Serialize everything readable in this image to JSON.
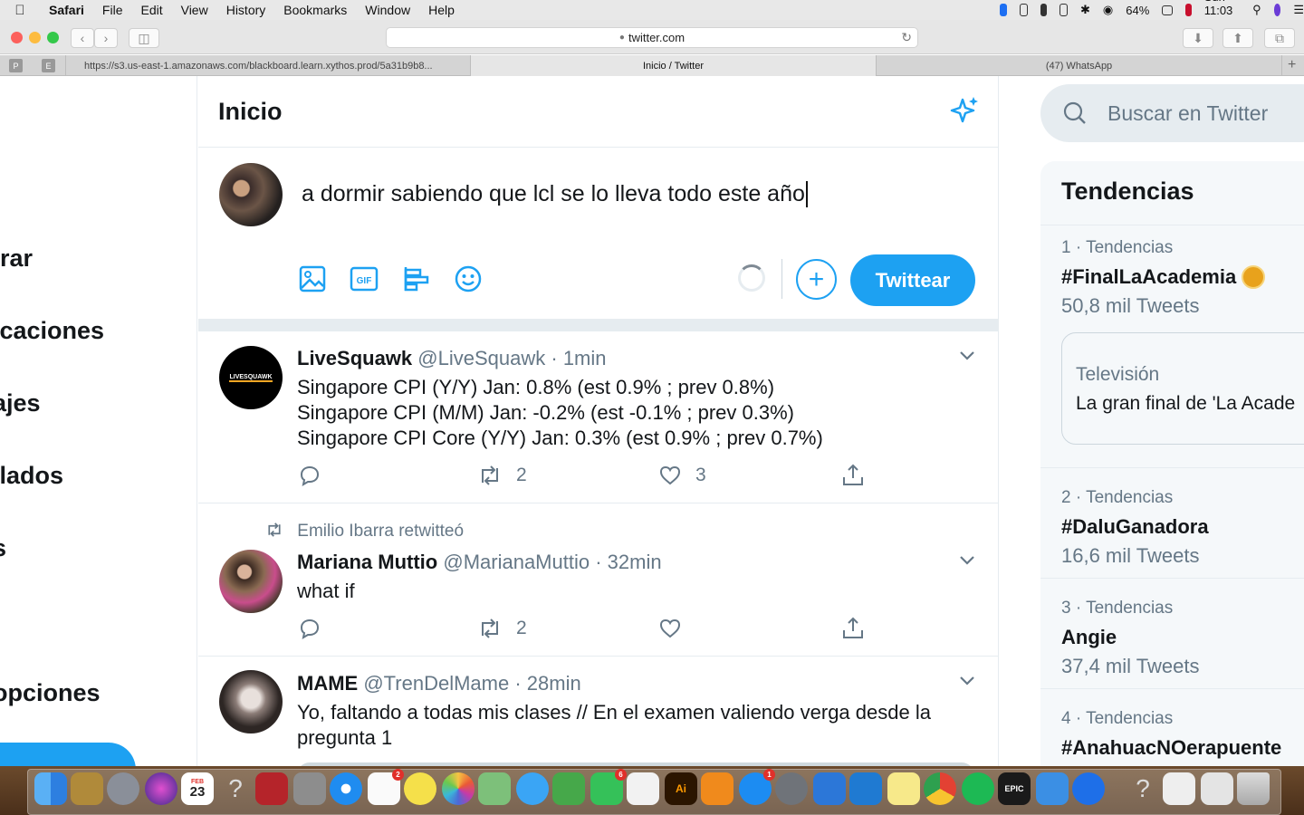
{
  "menubar": {
    "app": "Safari",
    "menus": [
      "File",
      "Edit",
      "View",
      "History",
      "Bookmarks",
      "Window",
      "Help"
    ],
    "battery": "64%",
    "clock": "Sun 11:03 PM"
  },
  "browser": {
    "address": "twitter.com",
    "tabs": [
      {
        "label": "https://s3.us-east-1.amazonaws.com/blackboard.learn.xythos.prod/5a31b9b8..."
      },
      {
        "label": "Inicio / Twitter"
      },
      {
        "label": "(47) WhatsApp"
      }
    ],
    "pinned": [
      "P",
      "E"
    ]
  },
  "leftnav": {
    "items": [
      "rar",
      "icaciones",
      "ajes",
      "ilados",
      "s",
      "opciones"
    ]
  },
  "header": {
    "title": "Inicio"
  },
  "composer": {
    "text": "a dormir sabiendo que lcl se lo lleva todo este año",
    "tweet_button": "Twittear"
  },
  "tweets": [
    {
      "name": "LiveSquawk",
      "handle": "@LiveSquawk",
      "time": "· 1min",
      "text": "Singapore CPI (Y/Y) Jan: 0.8% (est 0.9% ; prev 0.8%)\nSingapore CPI (M/M) Jan: -0.2% (est -0.1% ; prev 0.3%)\nSingapore CPI Core (Y/Y) Jan: 0.3% (est 0.9% ; prev 0.7%)",
      "retweets": "2",
      "likes": "3",
      "avatar_text": "LIVESQUAWK"
    },
    {
      "retweeted_by": "Emilio Ibarra retwitteó",
      "name": "Mariana Muttio",
      "handle": "@MarianaMuttio",
      "time": "· 32min",
      "text": "what if",
      "retweets": "2"
    },
    {
      "name": "MAME",
      "handle": "@TrenDelMame",
      "time": "· 28min",
      "text": "Yo, faltando a todas mis clases // En el examen valiendo verga desde la pregunta 1"
    }
  ],
  "sidebar": {
    "search_placeholder": "Buscar en Twitter",
    "trends_title": "Tendencias",
    "trends": [
      {
        "meta": "1 · Tendencias",
        "tag": "#FinalLaAcademia",
        "count": "50,8 mil Tweets"
      },
      {
        "meta": "2 · Tendencias",
        "tag": "#DaluGanadora",
        "count": "16,6 mil Tweets"
      },
      {
        "meta": "3 · Tendencias",
        "tag": "Angie",
        "count": "37,4 mil Tweets"
      },
      {
        "meta": "4 · Tendencias",
        "tag": "#AnahuacNOerapuente",
        "count": ""
      }
    ],
    "card": {
      "category": "Televisión",
      "headline": "La gran final de 'La Acade"
    }
  },
  "dock": {
    "calendar_day": "23",
    "calendar_month": "FEB",
    "badges": {
      "reminders": "2",
      "facetime": "6",
      "appstore": "1"
    }
  },
  "colors": {
    "accent": "#1da1f2",
    "secondary_text": "#657786",
    "divider": "#e6ecf0"
  }
}
